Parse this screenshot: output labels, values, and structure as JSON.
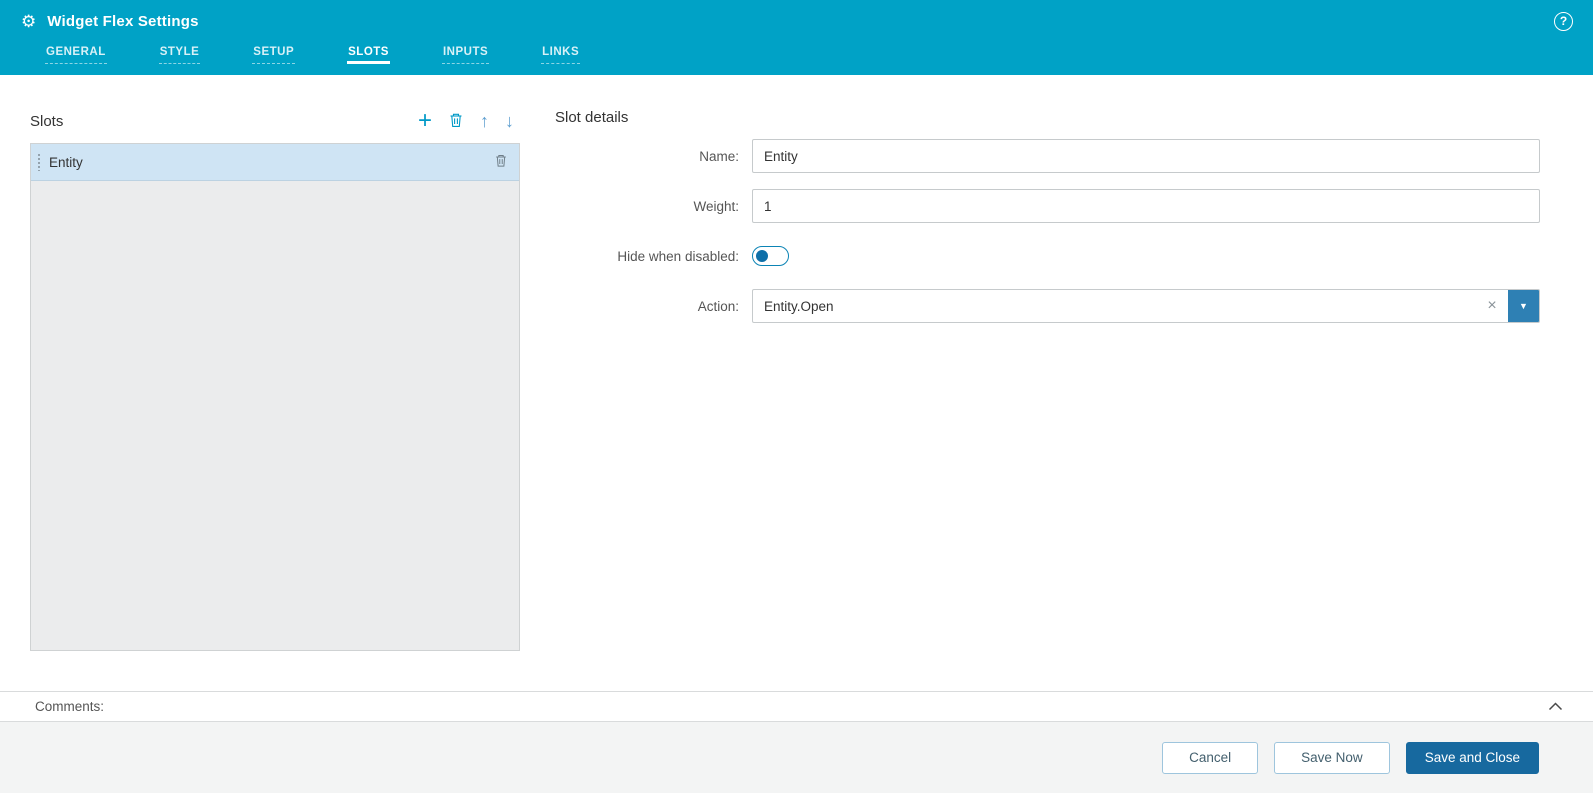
{
  "header": {
    "title": "Widget Flex Settings",
    "tabs": [
      {
        "label": "GENERAL",
        "active": false
      },
      {
        "label": "STYLE",
        "active": false
      },
      {
        "label": "SETUP",
        "active": false
      },
      {
        "label": "SLOTS",
        "active": true
      },
      {
        "label": "INPUTS",
        "active": false
      },
      {
        "label": "LINKS",
        "active": false
      }
    ]
  },
  "slots_panel": {
    "title": "Slots",
    "items": [
      {
        "label": "Entity",
        "selected": true
      }
    ]
  },
  "details_panel": {
    "title": "Slot details",
    "name": {
      "label": "Name:",
      "value": "Entity"
    },
    "weight": {
      "label": "Weight:",
      "value": "1"
    },
    "hide_when_disabled": {
      "label": "Hide when disabled:",
      "enabled": false
    },
    "action": {
      "label": "Action:",
      "value": "Entity.Open"
    }
  },
  "comments": {
    "label": "Comments:"
  },
  "footer": {
    "cancel": "Cancel",
    "save_now": "Save Now",
    "save_and_close": "Save and Close"
  },
  "icons": {
    "gear": "⚙",
    "help": "?",
    "add": "+",
    "move_up": "↑",
    "move_down": "↓",
    "clear": "×",
    "dropdown_caret": "▼"
  },
  "colors": {
    "header_bg": "#00a2c6",
    "accent": "#0099c7",
    "selected_item_bg": "#cfe4f4",
    "toggle_knob": "#0e6fa8",
    "dropdown_button_bg": "#2e80b4",
    "primary_button_bg": "#17699f",
    "secondary_button_border": "#9ec5dd"
  }
}
